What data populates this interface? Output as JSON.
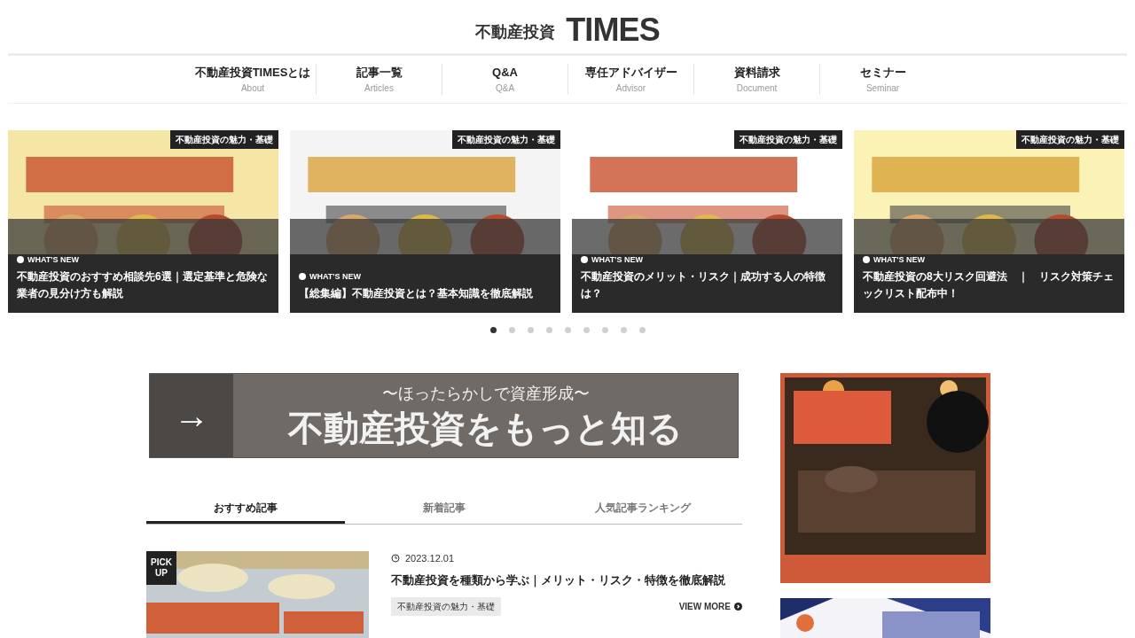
{
  "header": {
    "logo_jp": "不動産投資",
    "logo_en": "TIMES"
  },
  "nav": [
    {
      "label": "不動産投資TIMESとは",
      "sub": "About"
    },
    {
      "label": "記事一覧",
      "sub": "Articles"
    },
    {
      "label": "Q&A",
      "sub": "Q&A"
    },
    {
      "label": "専任アドバイザー",
      "sub": "Advisor"
    },
    {
      "label": "資料請求",
      "sub": "Document"
    },
    {
      "label": "セミナー",
      "sub": "Seminar"
    }
  ],
  "slides": [
    {
      "category": "不動産投資の魅力・基礎",
      "badge": "WHAT'S NEW",
      "title": "不動産投資のおすすめ相談先6選｜選定基準と危険な業者の見分け方も解説"
    },
    {
      "category": "不動産投資の魅力・基礎",
      "badge": "WHAT'S NEW",
      "title": "【総集編】不動産投資とは？基本知識を徹底解説"
    },
    {
      "category": "不動産投資の魅力・基礎",
      "badge": "WHAT'S NEW",
      "title": "不動産投資のメリット・リスク｜成功する人の特徴は？"
    },
    {
      "category": "不動産投資の魅力・基礎",
      "badge": "WHAT'S NEW",
      "title": "不動産投資の8大リスク回避法　｜　リスク対策チェックリスト配布中！"
    }
  ],
  "dots": [
    {
      "selected": true
    },
    {
      "selected": false
    },
    {
      "selected": false
    },
    {
      "selected": false
    },
    {
      "selected": false
    },
    {
      "selected": false
    },
    {
      "selected": false
    },
    {
      "selected": false
    },
    {
      "selected": false
    }
  ],
  "banner": {
    "arrow": "→",
    "subtitle": "〜ほったらかしで資産形成〜",
    "title": "不動産投資をもっと知る"
  },
  "tabs": [
    {
      "label": "おすすめ記事",
      "selected": true
    },
    {
      "label": "新着記事",
      "selected": false
    },
    {
      "label": "人気記事ランキング",
      "selected": false
    }
  ],
  "article": {
    "badge_line1": "PICK",
    "badge_line2": "UP",
    "date": "2023.12.01",
    "title": "不動産投資を種類から学ぶ｜メリット・リスク・特徴を徹底解説",
    "tag": "不動産投資の魅力・基礎",
    "more": "VIEW MORE"
  }
}
